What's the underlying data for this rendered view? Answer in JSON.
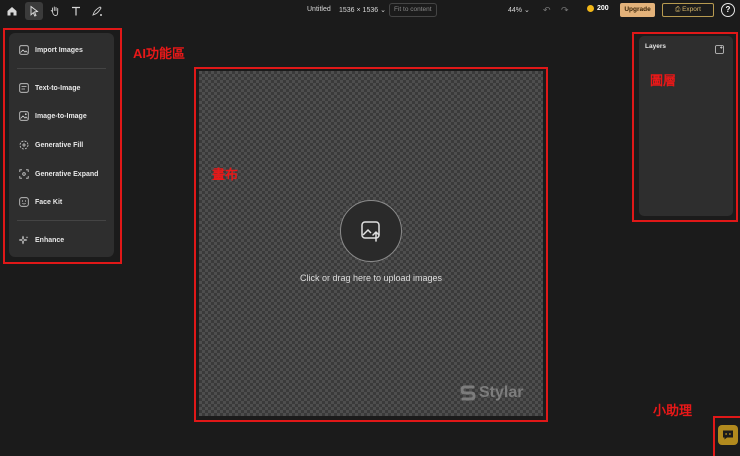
{
  "toolbar": {
    "tools": [
      "home-icon",
      "pointer-icon",
      "hand-icon",
      "text-icon",
      "pen-icon"
    ],
    "active_tool": "pointer-icon",
    "doc_title": "Untitled",
    "doc_size": "1536 × 1536 ⌄",
    "fit_label": "Fit to content",
    "zoom": "44% ⌄",
    "undo_icon": "↶",
    "redo_icon": "↷",
    "credits": "200",
    "upgrade_label": "Upgrade",
    "export_label": "⎙ Export",
    "help_label": "?"
  },
  "left_panel": {
    "annotation": "AI功能區",
    "items": [
      {
        "label": "Import Images",
        "icon": "image-import-icon"
      },
      {
        "label": "Text-to-Image",
        "icon": "text-to-image-icon"
      },
      {
        "label": "Image-to-Image",
        "icon": "image-to-image-icon"
      },
      {
        "label": "Generative Fill",
        "icon": "generative-fill-icon"
      },
      {
        "label": "Generative Expand",
        "icon": "generative-expand-icon"
      },
      {
        "label": "Face Kit",
        "icon": "face-icon"
      },
      {
        "label": "Enhance",
        "icon": "sparkle-icon"
      }
    ]
  },
  "canvas": {
    "annotation": "畫布",
    "upload_text": "Click or drag here to upload images",
    "watermark": "Stylar"
  },
  "layers": {
    "annotation": "圖層",
    "title": "Layers"
  },
  "assistant": {
    "annotation": "小助理"
  },
  "colors": {
    "annotation_red": "#e01818",
    "upgrade_bg": "#e3b27a",
    "export_border": "#b79a50",
    "coin": "#f2b718",
    "assistant_bg": "#b18a1e"
  }
}
